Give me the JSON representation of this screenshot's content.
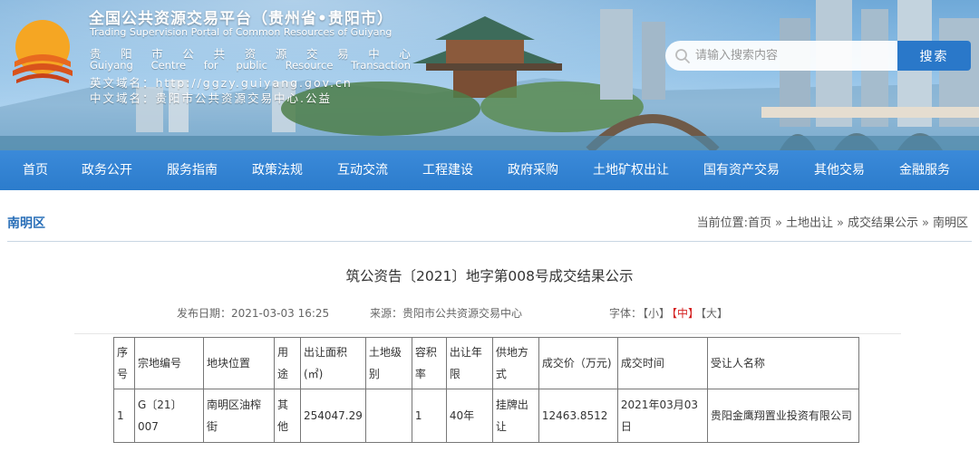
{
  "header": {
    "title_cn": "全国公共资源交易平台（贵州省•贵阳市）",
    "title_en": "Trading Supervision Portal of Common Resources of Guiyang",
    "sub_cn": [
      "贵",
      "阳",
      "市",
      "公",
      "共",
      "资",
      "源",
      "交",
      "易",
      "中",
      "心"
    ],
    "sub_en": [
      "Guiyang",
      "Centre",
      "for",
      "public",
      "Resource",
      "Transaction"
    ],
    "domain_en": "英文域名：http://ggzy.guiyang.gov.cn",
    "domain_cn": "中文域名：贵阳市公共资源交易中心.公益"
  },
  "search": {
    "placeholder": "请输入搜索内容",
    "button": "搜索"
  },
  "nav": [
    "首页",
    "政务公开",
    "服务指南",
    "政策法规",
    "互动交流",
    "工程建设",
    "政府采购",
    "土地矿权出让",
    "国有资产交易",
    "其他交易",
    "金融服务"
  ],
  "section_title": "南明区",
  "breadcrumb": {
    "prefix": "当前位置:",
    "items": [
      "首页",
      "土地出让",
      "成交结果公示",
      "南明区"
    ],
    "sep": "»"
  },
  "article": {
    "title": "筑公资告〔2021〕地字第008号成交结果公示",
    "date_label": "发布日期：",
    "date": "2021-03-03 16:25",
    "source_label": "来源：",
    "source": "贵阳市公共资源交易中心",
    "font_label": "字体：",
    "font_sizes": [
      "【小】",
      "【中】",
      "【大】"
    ],
    "font_active": 1
  },
  "table": {
    "headers": [
      "序号",
      "宗地编号",
      "地块位置",
      "用途",
      "出让面积(㎡)",
      "土地级别",
      "容积率",
      "出让年限",
      "供地方式",
      "成交价（万元)",
      "成交时间",
      "受让人名称"
    ],
    "rows": [
      [
        "1",
        "G〔21〕007",
        "南明区油榨街",
        "其他",
        "254047.29",
        "",
        "1",
        "40年",
        "挂牌出让",
        "12463.8512",
        "2021年03月03日",
        "贵阳金鹰翔置业投资有限公司"
      ]
    ]
  },
  "colors": {
    "nav_bg": "#2c7ccc",
    "search_button": "#2a78c9",
    "section_title": "#2a6fb8",
    "active_font": "#d42020"
  }
}
